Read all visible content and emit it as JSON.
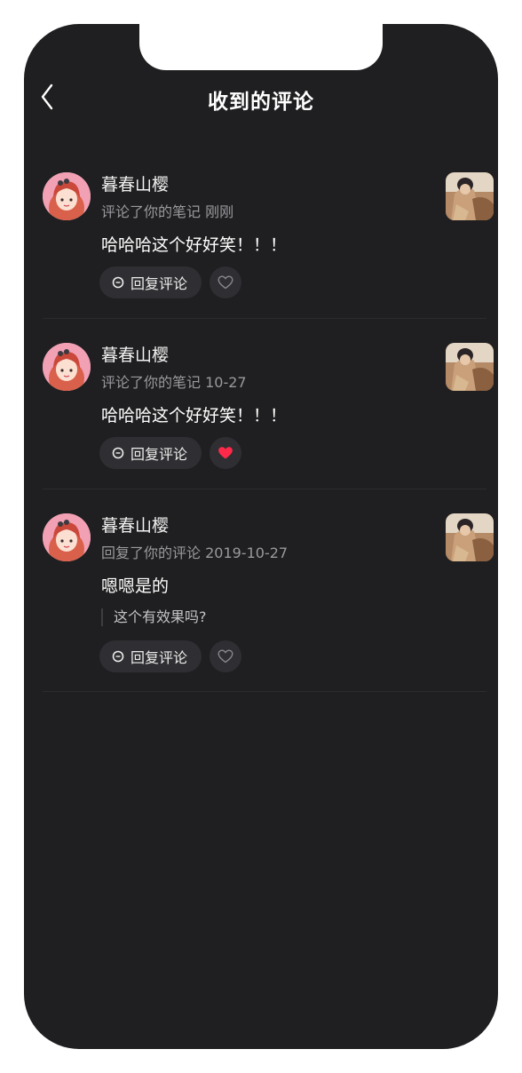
{
  "header": {
    "title": "收到的评论"
  },
  "comments": [
    {
      "username": "暮春山樱",
      "meta": "评论了你的笔记 刚刚",
      "text": "哈哈哈这个好好笑！！！",
      "quoted": null,
      "reply_label": "回复评论",
      "liked": false
    },
    {
      "username": "暮春山樱",
      "meta": "评论了你的笔记 10-27",
      "text": "哈哈哈这个好好笑！！！",
      "quoted": null,
      "reply_label": "回复评论",
      "liked": true
    },
    {
      "username": "暮春山樱",
      "meta": "回复了你的评论 2019-10-27",
      "text": "嗯嗯是的",
      "quoted": "这个有效果吗?",
      "reply_label": "回复评论",
      "liked": false
    }
  ],
  "colors": {
    "background": "#1f1f21",
    "like_active": "#ff2a4a",
    "like_inactive": "#8a8a8e"
  }
}
